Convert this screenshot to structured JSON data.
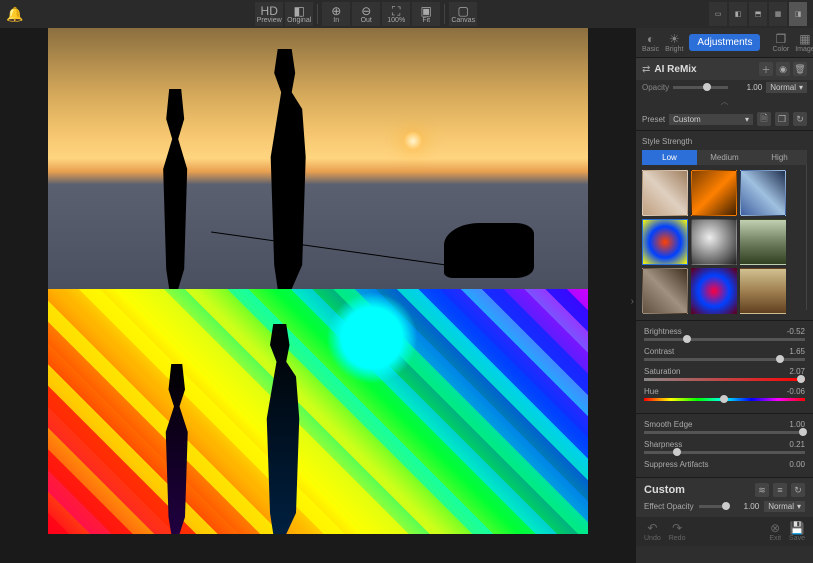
{
  "topbar": {
    "preview": "Preview",
    "original": "Original",
    "zoom_in": "In",
    "zoom_out": "Out",
    "zoom_100": "100%",
    "fit": "Fit",
    "canvas": "Canvas"
  },
  "side_tabs": {
    "basic": "Basic",
    "bright": "Bright",
    "adjustments": "Adjustments",
    "color": "Color",
    "image": "Image"
  },
  "effect": {
    "name": "AI ReMix",
    "opacity_label": "Opacity",
    "opacity_value": "1.00",
    "blend_mode": "Normal"
  },
  "preset": {
    "label": "Preset",
    "value": "Custom"
  },
  "style_strength": {
    "label": "Style Strength",
    "low": "Low",
    "medium": "Medium",
    "high": "High"
  },
  "sliders": {
    "brightness": {
      "label": "Brightness",
      "value": "-0.52",
      "pos": 24
    },
    "contrast": {
      "label": "Contrast",
      "value": "1.65",
      "pos": 82
    },
    "saturation": {
      "label": "Saturation",
      "value": "2.07",
      "pos": 95
    },
    "hue": {
      "label": "Hue",
      "value": "-0.06",
      "pos": 47
    },
    "smooth_edge": {
      "label": "Smooth Edge",
      "value": "1.00",
      "pos": 96
    },
    "sharpness": {
      "label": "Sharpness",
      "value": "0.21",
      "pos": 18
    },
    "suppress": {
      "label": "Suppress Artifacts",
      "value": "0.00",
      "pos": 2
    }
  },
  "bottom": {
    "title": "Custom",
    "effect_opacity_label": "Effect Opacity",
    "effect_opacity_value": "1.00",
    "blend": "Normal"
  },
  "footer": {
    "undo": "Undo",
    "redo": "Redo",
    "exit": "Exit",
    "save": "Save"
  }
}
